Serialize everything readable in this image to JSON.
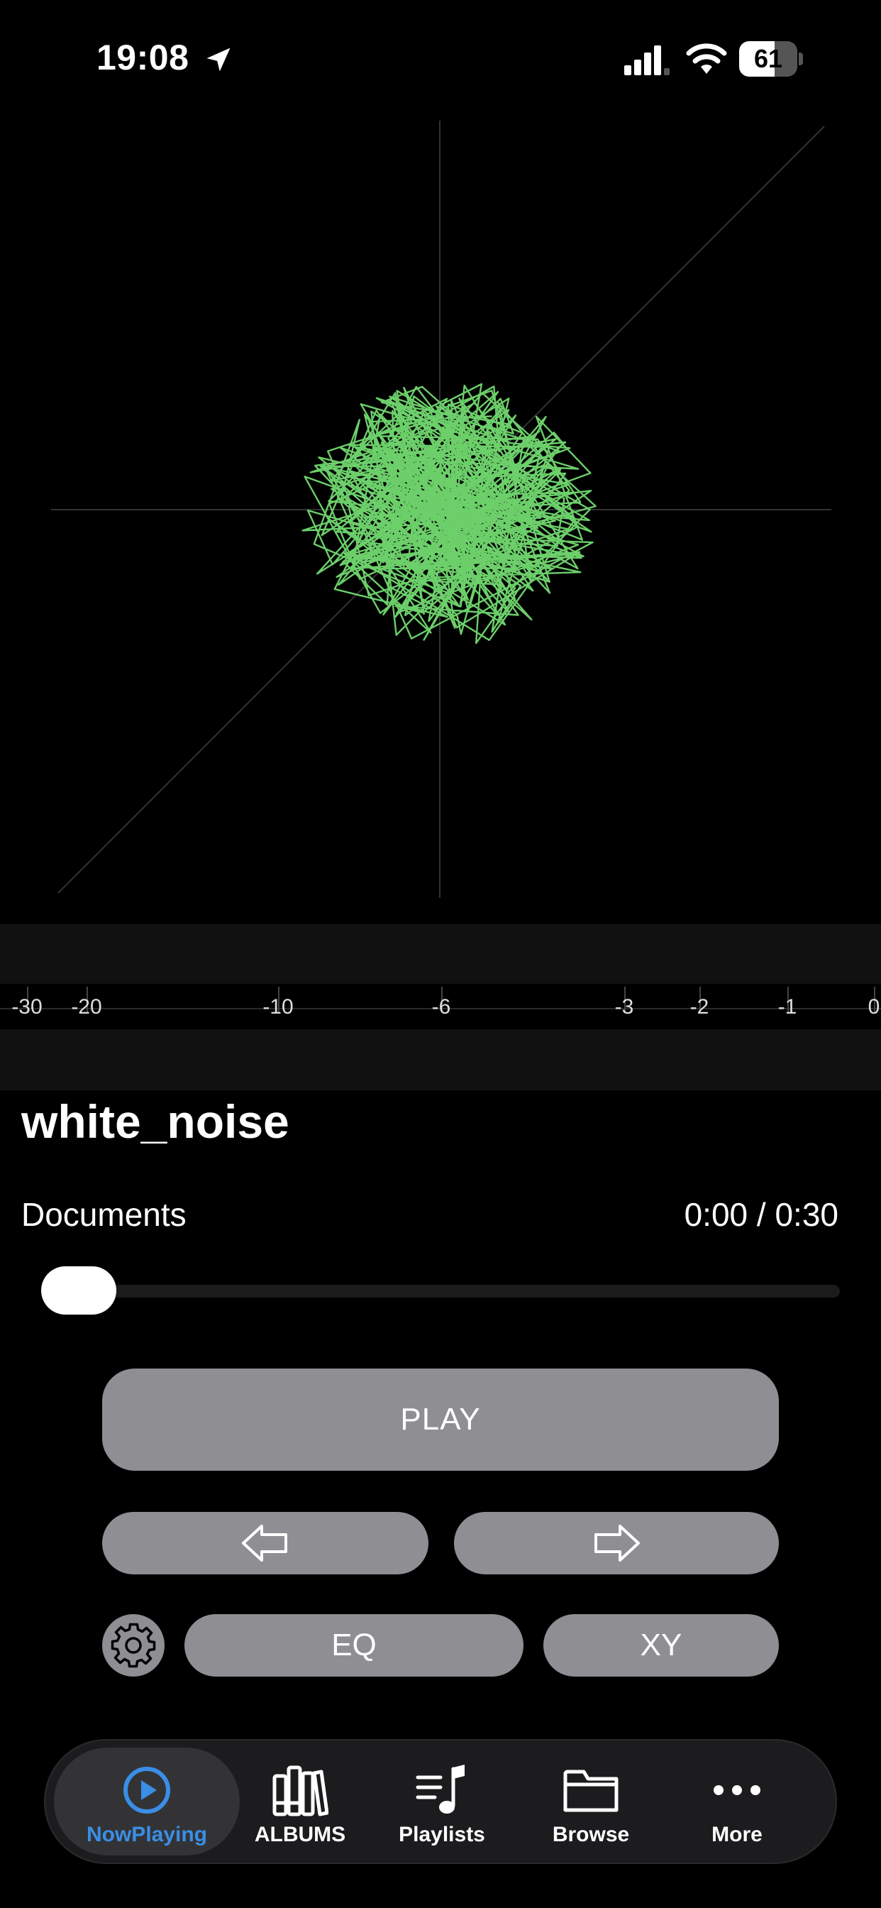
{
  "status_bar": {
    "time": "19:08",
    "battery_percent": "61",
    "battery_level": 0.61
  },
  "meter": {
    "ticks": [
      "-30",
      "-20",
      "-10",
      "-6",
      "-3",
      "-2",
      "-1",
      "0"
    ]
  },
  "track": {
    "title": "white_noise",
    "folder": "Documents",
    "time": "0:00 / 0:30",
    "progress": 0.0
  },
  "controls": {
    "play_label": "PLAY",
    "eq_label": "EQ",
    "xy_label": "XY"
  },
  "tabs": [
    {
      "label": "NowPlaying",
      "icon": "play-circle-icon",
      "active": true
    },
    {
      "label": "ALBUMS",
      "icon": "books-icon",
      "active": false
    },
    {
      "label": "Playlists",
      "icon": "music-list-icon",
      "active": false
    },
    {
      "label": "Browse",
      "icon": "folder-icon",
      "active": false
    },
    {
      "label": "More",
      "icon": "ellipsis-icon",
      "active": false
    }
  ],
  "colors": {
    "accent": "#3a8ee6",
    "scope_trace": "#6ccf6a",
    "button": "#8e8e93"
  }
}
